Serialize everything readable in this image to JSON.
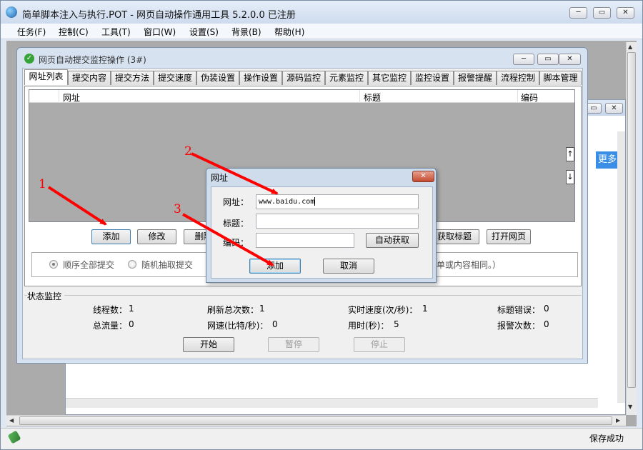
{
  "app": {
    "title": "简单脚本注入与执行.POT  - 网页自动操作通用工具 5.2.0.0  已注册",
    "menu": [
      "任务(F)",
      "控制(C)",
      "工具(T)",
      "窗口(W)",
      "设置(S)",
      "背景(B)",
      "帮助(H)"
    ],
    "status_text": "保存成功",
    "bg_button_label": "更多"
  },
  "monitor": {
    "title": "网页自动提交监控操作  (3#)",
    "tabs": [
      "网址列表",
      "提交内容",
      "提交方法",
      "提交速度",
      "伪装设置",
      "操作设置",
      "源码监控",
      "元素监控",
      "其它监控",
      "监控设置",
      "报警提醒",
      "流程控制",
      "脚本管理"
    ],
    "columns": [
      "网址",
      "标题",
      "编码"
    ],
    "buttons": {
      "add": "添加",
      "edit": "修改",
      "delete": "删除",
      "get_title": "获取标题",
      "open_page": "打开网页"
    },
    "radios": [
      {
        "label": "顺序全部提交",
        "checked": true
      },
      {
        "label": "随机抽取提交",
        "checked": false
      }
    ],
    "hint_text": "表单或内容相同。）",
    "status_group_title": "状态监控",
    "stats": [
      {
        "label": "线程数：",
        "value": "1"
      },
      {
        "label": "刷新总次数：",
        "value": "1"
      },
      {
        "label": "实时速度(次/秒)：",
        "value": "1"
      },
      {
        "label": "标题错误：",
        "value": "0"
      },
      {
        "label": "总流量：",
        "value": "0"
      },
      {
        "label": "网速(比特/秒)：",
        "value": "0"
      },
      {
        "label": "用时(秒)：",
        "value": "5"
      },
      {
        "label": "报警次数：",
        "value": "0"
      }
    ],
    "controls": {
      "start": "开始",
      "pause": "暂停",
      "stop": "停止"
    }
  },
  "dialog": {
    "title": "网址",
    "url_label": "网址：",
    "url_value": "www.baidu.com",
    "title_label": "标题：",
    "title_value": "",
    "encoding_label": "编码：",
    "encoding_value": "",
    "auto_get": "自动获取",
    "add": "添加",
    "cancel": "取消"
  },
  "annotations": [
    "1",
    "2",
    "3"
  ],
  "colors": {
    "arrow": "#ff0000",
    "list_bg": "#ababab",
    "accent": "#3a8ee6"
  }
}
